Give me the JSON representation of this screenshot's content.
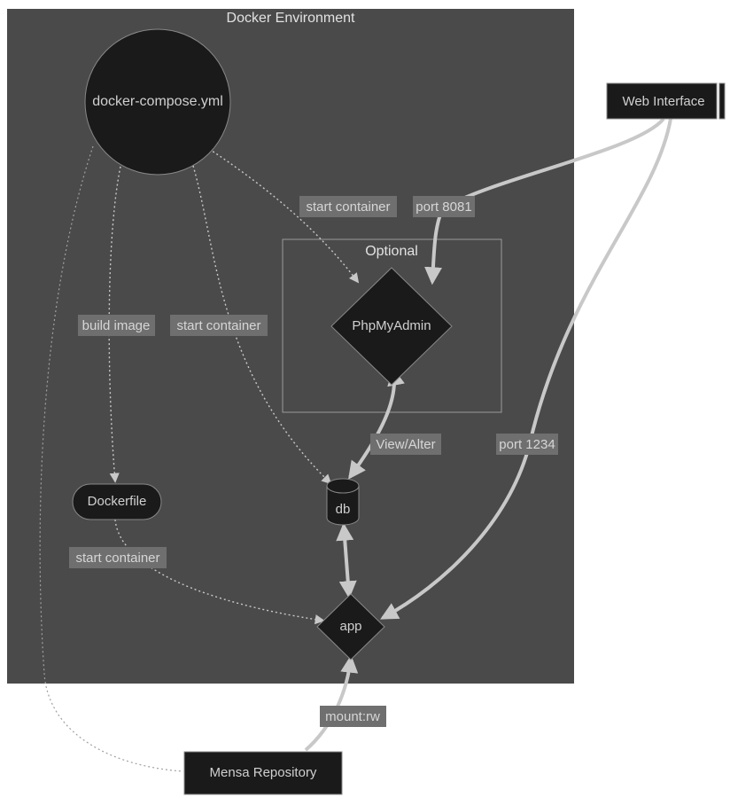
{
  "subgraphs": {
    "docker_env": {
      "title": "Docker Environment"
    },
    "optional": {
      "title": "Optional"
    }
  },
  "nodes": {
    "compose": {
      "label": "docker-compose.yml"
    },
    "dockerfile": {
      "label": "Dockerfile"
    },
    "phpmyadmin": {
      "label": "PhpMyAdmin"
    },
    "db": {
      "label": "db"
    },
    "app": {
      "label": "app"
    },
    "web": {
      "label": "Web Interface"
    },
    "repo": {
      "label": "Mensa Repository"
    }
  },
  "edges": {
    "build_image": {
      "label": "build image"
    },
    "start_container_1": {
      "label": "start container"
    },
    "start_container_2": {
      "label": "start container"
    },
    "start_container_3": {
      "label": "start container"
    },
    "port_8081": {
      "label": "port 8081"
    },
    "port_1234": {
      "label": "port 1234"
    },
    "view_alter": {
      "label": "View/Alter"
    },
    "mount_rw": {
      "label": "mount:rw"
    }
  },
  "colors": {
    "subgraph_bg": "#4a4a4a",
    "node_fill": "#1a1a1a",
    "node_stroke": "#888888",
    "text": "#d0d0d0",
    "edge": "#c8c8c8",
    "label_bg": "#6f6f6f"
  }
}
